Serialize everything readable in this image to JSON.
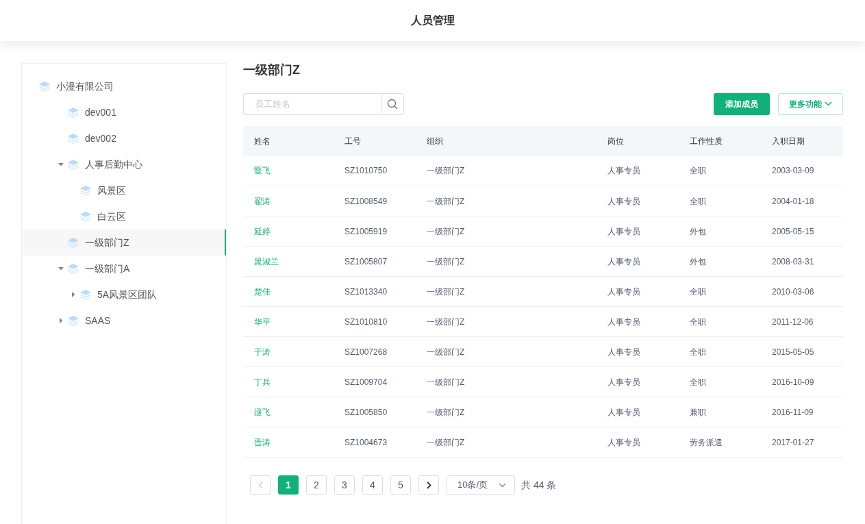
{
  "header": {
    "title": "人员管理"
  },
  "tree": [
    {
      "label": "小漫有限公司",
      "selected": false,
      "children": [
        {
          "label": "dev001",
          "selected": false
        },
        {
          "label": "dev002",
          "selected": false
        },
        {
          "label": "人事后勤中心",
          "selected": false,
          "expanded": true,
          "children": [
            {
              "label": "风景区",
              "selected": false
            },
            {
              "label": "白云区",
              "selected": false
            }
          ]
        },
        {
          "label": "一级部门Z",
          "selected": true
        },
        {
          "label": "一级部门A",
          "selected": false,
          "expanded": true,
          "children": [
            {
              "label": "5A风景区团队",
              "selected": false,
              "expanded": false
            }
          ]
        },
        {
          "label": "SAAS",
          "selected": false,
          "expanded": false
        }
      ]
    }
  ],
  "main": {
    "title": "一级部门Z",
    "search": {
      "placeholder": "员工姓名"
    },
    "buttons": {
      "add": "添加成员",
      "more": "更多功能"
    }
  },
  "table": {
    "columns": [
      "姓名",
      "工号",
      "组织",
      "岗位",
      "工作性质",
      "入职日期"
    ],
    "rows": [
      [
        "暨飞",
        "SZ1010750",
        "一级部门Z",
        "人事专员",
        "全职",
        "2003-03-09"
      ],
      [
        "翟涛",
        "SZ1008549",
        "一级部门Z",
        "人事专员",
        "全职",
        "2004-01-18"
      ],
      [
        "延婷",
        "SZ1005919",
        "一级部门Z",
        "人事专员",
        "外包",
        "2005-05-15"
      ],
      [
        "晁淑兰",
        "SZ1005807",
        "一级部门Z",
        "人事专员",
        "外包",
        "2008-03-31"
      ],
      [
        "楚佳",
        "SZ1013340",
        "一级部门Z",
        "人事专员",
        "全职",
        "2010-03-06"
      ],
      [
        "华平",
        "SZ1010810",
        "一级部门Z",
        "人事专员",
        "全职",
        "2011-12-06"
      ],
      [
        "于涛",
        "SZ1007268",
        "一级部门Z",
        "人事专员",
        "全职",
        "2015-05-05"
      ],
      [
        "丁兵",
        "SZ1009704",
        "一级部门Z",
        "人事专员",
        "全职",
        "2016-10-09"
      ],
      [
        "逯飞",
        "SZ1005850",
        "一级部门Z",
        "人事专员",
        "兼职",
        "2016-11-09"
      ],
      [
        "晋涛",
        "SZ1004673",
        "一级部门Z",
        "人事专员",
        "劳务派遣",
        "2017-01-27"
      ]
    ]
  },
  "pagination": {
    "prev_disabled": true,
    "next_disabled": false,
    "pages": [
      {
        "label": "1",
        "selected": true
      },
      {
        "label": "2",
        "selected": false
      },
      {
        "label": "3",
        "selected": false
      },
      {
        "label": "4",
        "selected": false
      },
      {
        "label": "5",
        "selected": false
      }
    ],
    "page_size": "10条/页",
    "total": "共 44 条"
  }
}
